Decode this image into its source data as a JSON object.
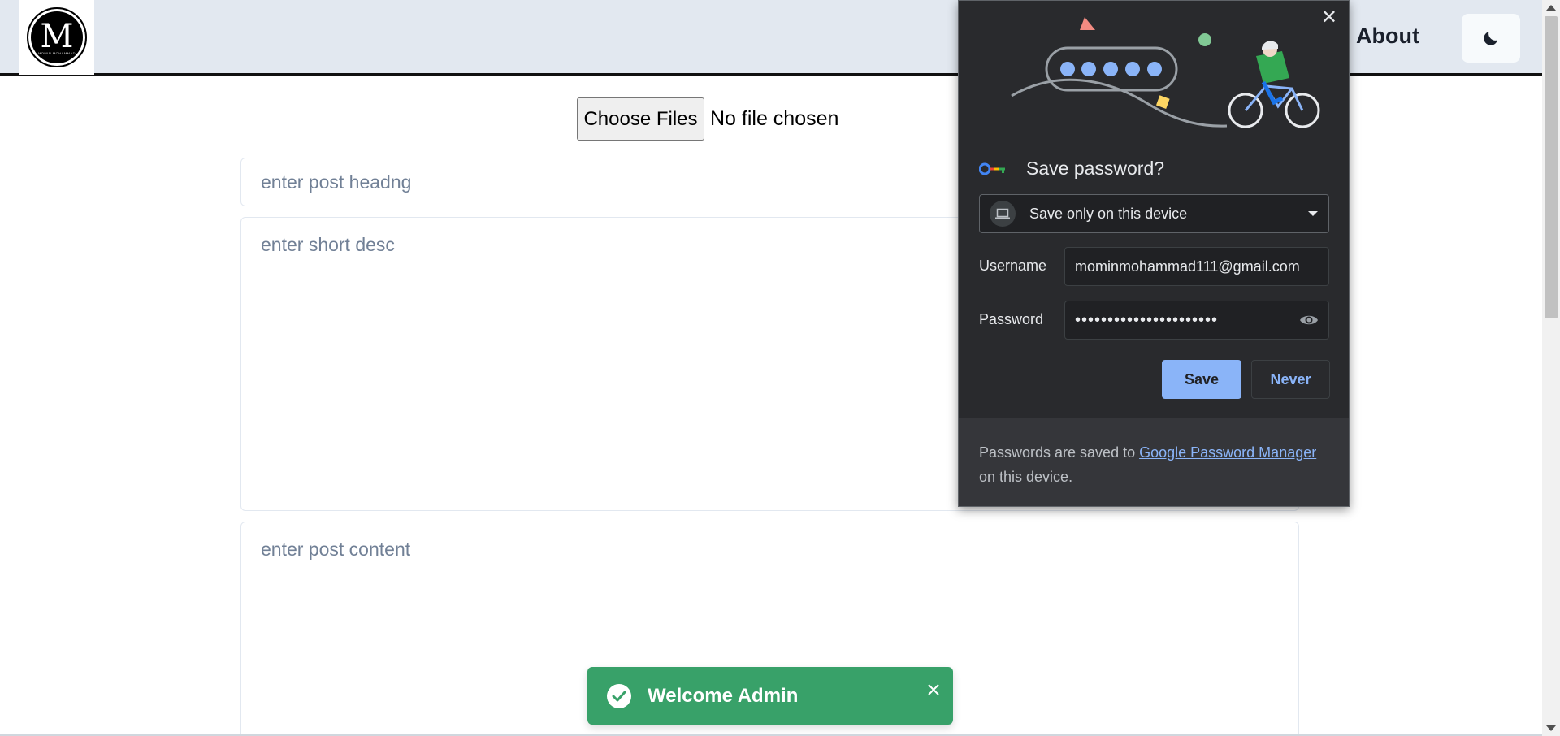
{
  "header": {
    "logo_letter": "M",
    "logo_subtext": "MOMIN MOHAMMAD",
    "nav_about": "About",
    "theme_icon": "moon-icon"
  },
  "form": {
    "choose_files_label": "Choose Files",
    "file_status": "No file chosen",
    "heading_placeholder": "enter post headng",
    "desc_placeholder": "enter short desc",
    "content_placeholder": "enter post content"
  },
  "password_popup": {
    "title": "Save password?",
    "storage_option": "Save only on this device",
    "username_label": "Username",
    "username_value": "mominmohammad111@gmail.com",
    "password_label": "Password",
    "password_mask": "••••••••••••••••••••••",
    "save_label": "Save",
    "never_label": "Never",
    "footer_prefix": "Passwords are saved to ",
    "footer_link": "Google Password Manager",
    "footer_suffix": " on this device.",
    "colors": {
      "accent": "#8ab4f8",
      "background": "#292a2d"
    }
  },
  "toast": {
    "message": "Welcome Admin",
    "color": "#38a169"
  }
}
